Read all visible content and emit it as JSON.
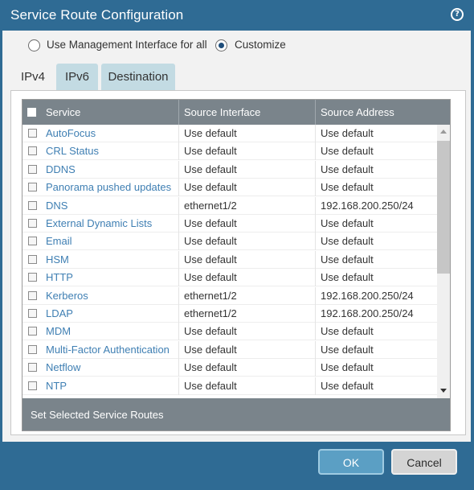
{
  "dialog": {
    "title": "Service Route Configuration",
    "help_icon": "help-icon"
  },
  "radios": {
    "management": {
      "label": "Use Management Interface for all",
      "checked": false
    },
    "customize": {
      "label": "Customize",
      "checked": true
    }
  },
  "tabs": [
    {
      "label": "IPv4",
      "active": true
    },
    {
      "label": "IPv6",
      "active": false
    },
    {
      "label": "Destination",
      "active": false
    }
  ],
  "table": {
    "headers": {
      "service": "Service",
      "source_interface": "Source Interface",
      "source_address": "Source Address"
    },
    "rows": [
      {
        "service": "AutoFocus",
        "iface": "Use default",
        "addr": "Use default"
      },
      {
        "service": "CRL Status",
        "iface": "Use default",
        "addr": "Use default"
      },
      {
        "service": "DDNS",
        "iface": "Use default",
        "addr": "Use default"
      },
      {
        "service": "Panorama pushed updates",
        "iface": "Use default",
        "addr": "Use default"
      },
      {
        "service": "DNS",
        "iface": "ethernet1/2",
        "addr": "192.168.200.250/24"
      },
      {
        "service": "External Dynamic Lists",
        "iface": "Use default",
        "addr": "Use default"
      },
      {
        "service": "Email",
        "iface": "Use default",
        "addr": "Use default"
      },
      {
        "service": "HSM",
        "iface": "Use default",
        "addr": "Use default"
      },
      {
        "service": "HTTP",
        "iface": "Use default",
        "addr": "Use default"
      },
      {
        "service": "Kerberos",
        "iface": "ethernet1/2",
        "addr": "192.168.200.250/24"
      },
      {
        "service": "LDAP",
        "iface": "ethernet1/2",
        "addr": "192.168.200.250/24"
      },
      {
        "service": "MDM",
        "iface": "Use default",
        "addr": "Use default"
      },
      {
        "service": "Multi-Factor Authentication",
        "iface": "Use default",
        "addr": "Use default"
      },
      {
        "service": "Netflow",
        "iface": "Use default",
        "addr": "Use default"
      },
      {
        "service": "NTP",
        "iface": "Use default",
        "addr": "Use default"
      }
    ],
    "footer": "Set Selected Service Routes"
  },
  "buttons": {
    "ok": "OK",
    "cancel": "Cancel"
  },
  "colors": {
    "title_bar": "#2f6b94",
    "link": "#3f7fb3",
    "table_header": "#7a848b",
    "tab_inactive": "#c3dbe3",
    "ok_button": "#5b9fc4"
  }
}
